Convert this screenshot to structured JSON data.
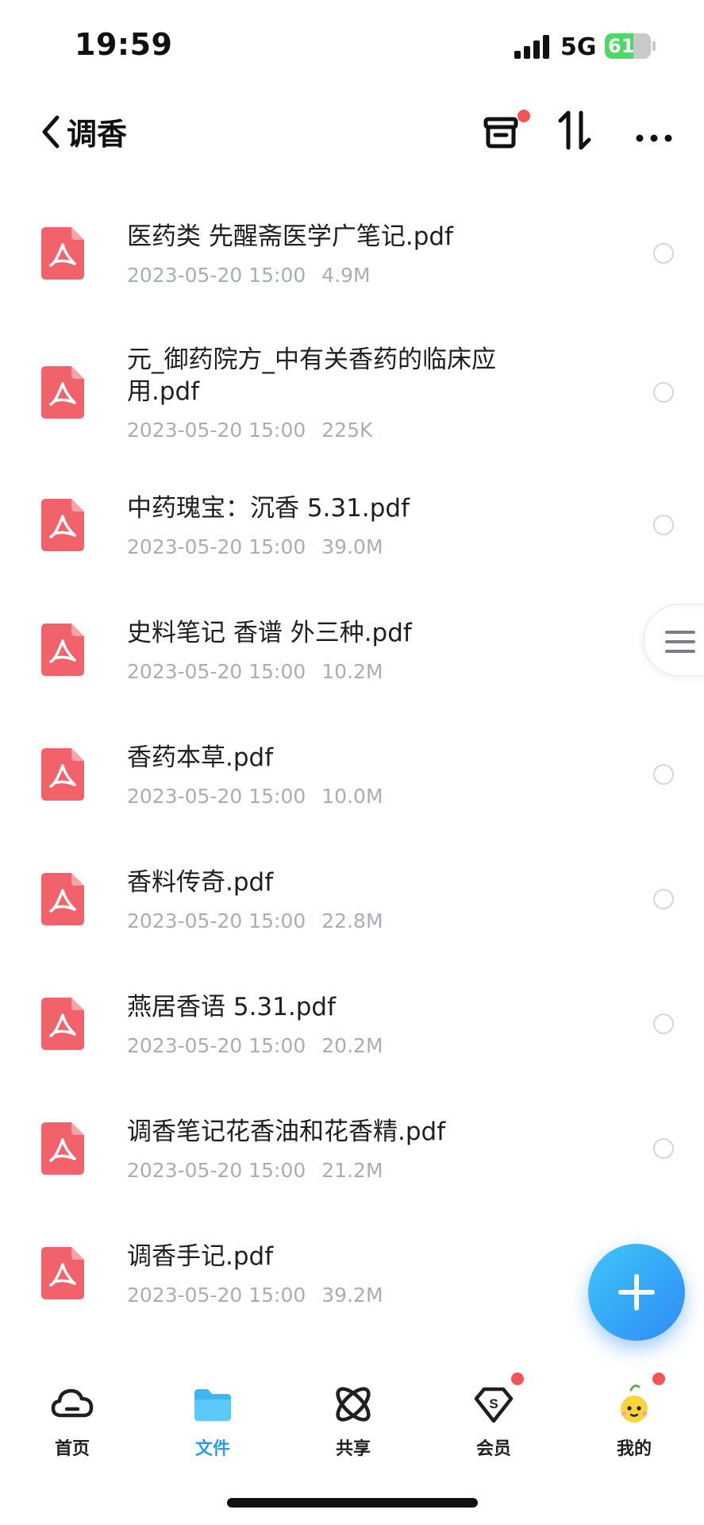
{
  "status_bar": {
    "time": "19:59",
    "network": "5G",
    "battery": "61"
  },
  "header": {
    "title": "调香",
    "icons": [
      "back-icon",
      "recycle-bin-icon",
      "sort-icon",
      "more-icon"
    ],
    "notification_dot_color": "#f25555"
  },
  "files": [
    {
      "name": "医药类 先醒斋医学广笔记.pdf",
      "date": "2023-05-20 15:00",
      "size": "4.9M"
    },
    {
      "name": "元_御药院方_中有关香药的临床应用.pdf",
      "date": "2023-05-20 15:00",
      "size": "225K"
    },
    {
      "name": "中药瑰宝：沉香 5.31.pdf",
      "date": "2023-05-20 15:00",
      "size": "39.0M"
    },
    {
      "name": "史料笔记 香谱 外三种.pdf",
      "date": "2023-05-20 15:00",
      "size": "10.2M"
    },
    {
      "name": "香药本草.pdf",
      "date": "2023-05-20 15:00",
      "size": "10.0M"
    },
    {
      "name": "香料传奇.pdf",
      "date": "2023-05-20 15:00",
      "size": "22.8M"
    },
    {
      "name": "燕居香语 5.31.pdf",
      "date": "2023-05-20 15:00",
      "size": "20.2M"
    },
    {
      "name": "调香笔记花香油和花香精.pdf",
      "date": "2023-05-20 15:00",
      "size": "21.2M"
    },
    {
      "name": "调香手记.pdf",
      "date": "2023-05-20 15:00",
      "size": "39.2M"
    }
  ],
  "fab": {
    "icon": "plus-icon",
    "color": "#2f8bf6"
  },
  "bottom_nav": [
    {
      "label": "首页",
      "icon": "cloud-icon",
      "active": false
    },
    {
      "label": "文件",
      "icon": "folder-icon",
      "active": true
    },
    {
      "label": "共享",
      "icon": "share-orbit-icon",
      "active": false
    },
    {
      "label": "会员",
      "icon": "vip-diamond-icon",
      "active": false
    },
    {
      "label": "我的",
      "icon": "mascot-avatar-icon",
      "active": false
    }
  ],
  "colors": {
    "accent": "#2b9af3",
    "pdf_icon": "#f1626a",
    "meta_text": "#a9adb6"
  }
}
